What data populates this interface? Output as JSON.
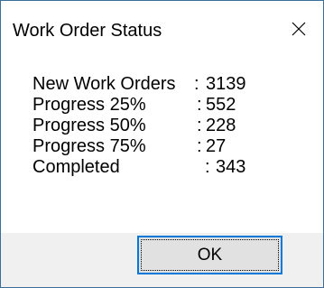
{
  "window": {
    "title": "Work Order Status",
    "close_icon": "close-icon",
    "border_color": "#3c6e9a"
  },
  "status_items": [
    {
      "label": "New Work Orders",
      "separator": ":",
      "value": "3139"
    },
    {
      "label": "Progress 25%",
      "separator": ":",
      "value": "552"
    },
    {
      "label": "Progress 50%",
      "separator": ":",
      "value": "228"
    },
    {
      "label": "Progress 75%",
      "separator": ":",
      "value": "27"
    },
    {
      "label": "Completed",
      "separator": ":",
      "value": "343"
    }
  ],
  "buttons": {
    "ok_label": "OK",
    "focus_color": "#0078d7"
  }
}
